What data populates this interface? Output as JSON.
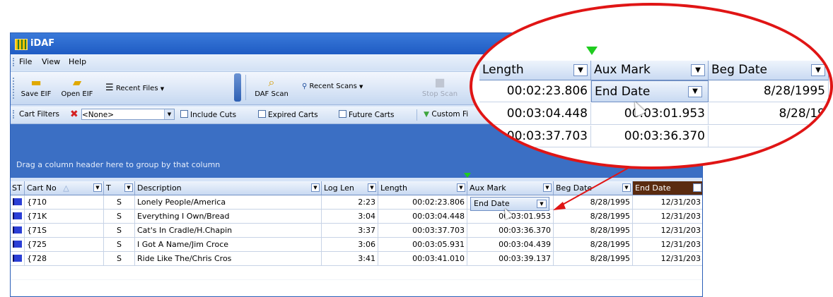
{
  "window": {
    "title": "iDAF"
  },
  "menu": {
    "items": [
      "File",
      "View",
      "Help"
    ]
  },
  "toolbar": {
    "save_eif": "Save EIF",
    "open_eif": "Open EIF",
    "recent_files": "Recent Files",
    "daf_scan": "DAF Scan",
    "recent_scans": "Recent Scans",
    "stop_scan": "Stop Scan"
  },
  "filters": {
    "cart_filters_label": "Cart Filters",
    "cart_filter_value": "<None>",
    "include_cuts": "Include Cuts",
    "expired_carts": "Expired Carts",
    "future_carts": "Future Carts",
    "custom_filter": "Custom Fi"
  },
  "group_panel": {
    "hint": "Drag a column header here to group by that column"
  },
  "grid": {
    "columns": [
      "ST",
      "Cart No",
      "T",
      "Description",
      "Log Len",
      "Length",
      "Aux Mark",
      "Beg Date",
      "End Date"
    ],
    "sort_indicator": "△",
    "rows": [
      {
        "cart": "{710",
        "t": "S",
        "desc": "Lonely People/America",
        "loglen": "2:23",
        "length": "00:02:23.806",
        "aux": "",
        "beg": "8/28/1995",
        "end": "12/31/203"
      },
      {
        "cart": "{71K",
        "t": "S",
        "desc": "Everything I Own/Bread",
        "loglen": "3:04",
        "length": "00:03:04.448",
        "aux": "00:03:01.953",
        "beg": "8/28/1995",
        "end": "12/31/203"
      },
      {
        "cart": "{71S",
        "t": "S",
        "desc": "Cat's In Cradle/H.Chapin",
        "loglen": "3:37",
        "length": "00:03:37.703",
        "aux": "00:03:36.370",
        "beg": "8/28/1995",
        "end": "12/31/203"
      },
      {
        "cart": "{725",
        "t": "S",
        "desc": "I Got A Name/Jim Croce",
        "loglen": "3:06",
        "length": "00:03:05.931",
        "aux": "00:03:04.439",
        "beg": "8/28/1995",
        "end": "12/31/203"
      },
      {
        "cart": "{728",
        "t": "S",
        "desc": "Ride Like The/Chris Cros",
        "loglen": "3:41",
        "length": "00:03:41.010",
        "aux": "00:03:39.137",
        "beg": "8/28/1995",
        "end": "12/31/203"
      }
    ],
    "floating_header": "End Date"
  },
  "zoom": {
    "headers": [
      "Length",
      "Aux Mark",
      "Beg Date"
    ],
    "rows": [
      {
        "length": "00:02:23.806",
        "aux": "End Date",
        "beg": "8/28/1995"
      },
      {
        "length": "00:03:04.448",
        "aux": "00:03:01.953",
        "beg": "8/28/19"
      },
      {
        "length": "00:03:37.703",
        "aux": "00:03:36.370",
        "beg": ""
      }
    ]
  },
  "colors": {
    "accent": "#3b6fc4",
    "highlight_ring": "#e01515",
    "drag_arrow": "#1fcc1f"
  }
}
